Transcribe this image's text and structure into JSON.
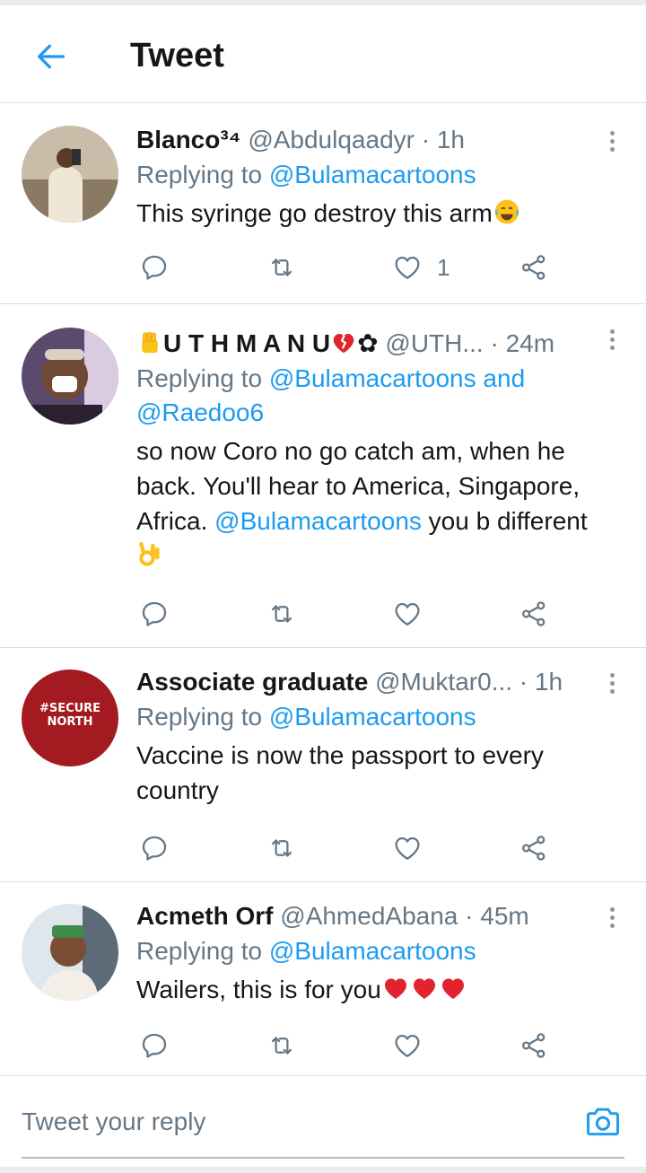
{
  "header": {
    "title": "Tweet",
    "back_icon": "arrow-left-icon"
  },
  "colors": {
    "accent": "#1d9bf0",
    "secondary_text": "#657786",
    "divider": "#d9dee3"
  },
  "tweets": [
    {
      "name": "Blanco³⁴",
      "handle": "@Abdulqaadyr",
      "separator": " · ",
      "time": "1h",
      "replying_prefix": "Replying to ",
      "replying_to": "@Bulamacartoons",
      "text": "This syringe go destroy this arm",
      "text_emoji": "laughing-tears-emoji",
      "like_count": "1"
    },
    {
      "name_emoji": "raised-fist-emoji",
      "name": "U T H M A N U",
      "name_suffix_emoji": "broken-heart-emoji",
      "name_suffix": "✿",
      "handle": "@UTH...",
      "separator": " · ",
      "time": "24m",
      "replying_prefix": "Replying to ",
      "replying_to": "@Bulamacartoons",
      "replying_and": " and",
      "replying_to_2": "@Raedoo6",
      "text_part1": "so now Coro no go catch am, when he back. You'll hear to America, Singapore, Africa. ",
      "text_mention": "@Bulamacartoons",
      "text_part2": " you b different",
      "text_emoji": "ok-hand-emoji"
    },
    {
      "name": "Associate graduate",
      "handle": "@Muktar0...",
      "separator": " · ",
      "time": "1h",
      "replying_prefix": "Replying to ",
      "replying_to": "@Bulamacartoons",
      "text": "Vaccine is now the passport to every country",
      "avatar_line1": "#SECURE",
      "avatar_line2": "NORTH"
    },
    {
      "name": "Acmeth Orf",
      "handle": "@AhmedAbana",
      "separator": " · ",
      "time": "45m",
      "replying_prefix": "Replying to ",
      "replying_to": "@Bulamacartoons",
      "text": "Wailers, this is for you",
      "text_emoji": "red-heart-emoji x3"
    }
  ],
  "composer": {
    "placeholder": "Tweet your reply",
    "camera_icon": "camera-icon"
  }
}
